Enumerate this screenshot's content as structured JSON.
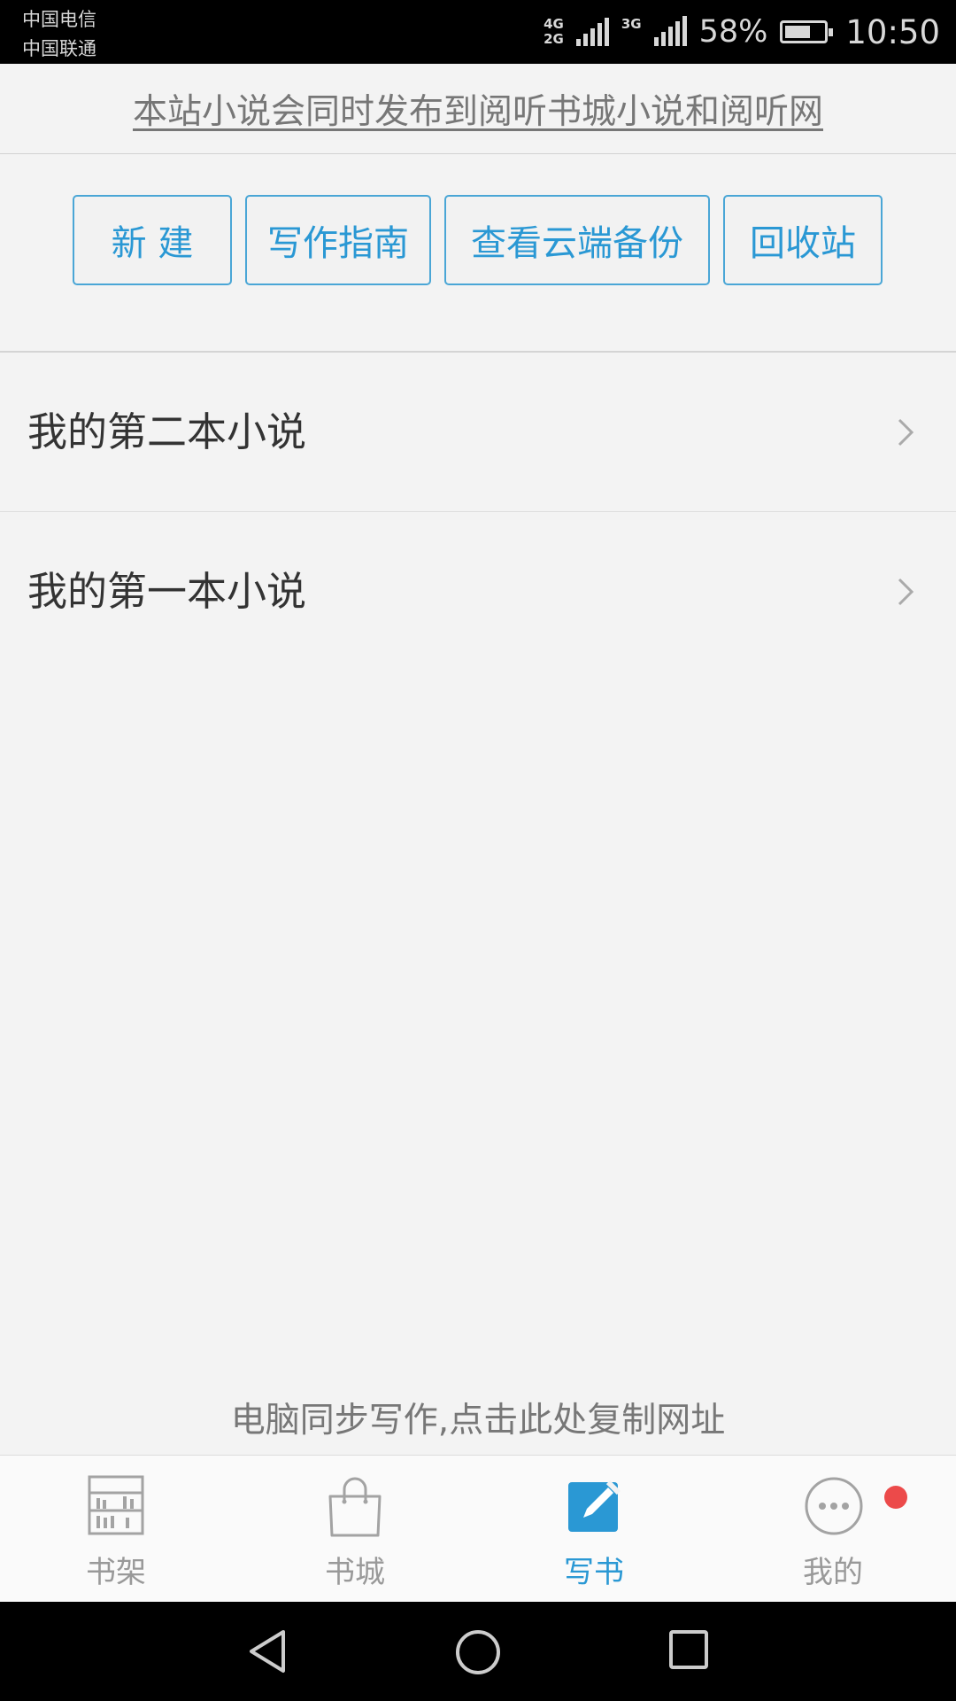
{
  "status_bar": {
    "carrier_1": "中国电信",
    "carrier_2": "中国联通",
    "network_1": "4G",
    "network_2": "2G",
    "network_3": "3G",
    "battery": "58%",
    "time": "10:50"
  },
  "notice": "本站小说会同时发布到阅听书城小说和阅听网",
  "actions": {
    "new": "新 建",
    "guide": "写作指南",
    "cloud_backup": "查看云端备份",
    "recycle": "回收站"
  },
  "novels": [
    {
      "title": "我的第二本小说"
    },
    {
      "title": "我的第一本小说"
    }
  ],
  "sync_link": "电脑同步写作,点击此处复制网址",
  "tabs": [
    {
      "label": "书架",
      "icon": "bookshelf-icon"
    },
    {
      "label": "书城",
      "icon": "shopping-bag-icon"
    },
    {
      "label": "写书",
      "icon": "edit-icon",
      "active": true
    },
    {
      "label": "我的",
      "icon": "more-dots-icon",
      "badge": true
    }
  ],
  "colors": {
    "accent": "#2a98d4",
    "badge": "#ec4a4a",
    "background": "#f3f3f3"
  }
}
